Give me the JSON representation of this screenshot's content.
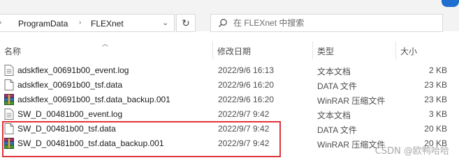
{
  "address_bar": {
    "crumbs": [
      "ProgramData",
      "FLEXnet"
    ],
    "search_placeholder": "在 FLEXnet 中搜索"
  },
  "columns": {
    "name": "名称",
    "date": "修改日期",
    "type": "类型",
    "size": "大小"
  },
  "files": [
    {
      "name": "adskflex_00691b00_event.log",
      "date": "2022/9/6 16:13",
      "type": "文本文档",
      "size": "2 KB",
      "icon": "text-file-icon"
    },
    {
      "name": "adskflex_00691b00_tsf.data",
      "date": "2022/9/6 16:20",
      "type": "DATA 文件",
      "size": "23 KB",
      "icon": "blank-file-icon"
    },
    {
      "name": "adskflex_00691b00_tsf.data_backup.001",
      "date": "2022/9/6 16:20",
      "type": "WinRAR 压缩文件",
      "size": "23 KB",
      "icon": "winrar-archive-icon"
    },
    {
      "name": "SW_D_00481b00_event.log",
      "date": "2022/9/7 9:42",
      "type": "文本文档",
      "size": "3 KB",
      "icon": "text-file-icon"
    },
    {
      "name": "SW_D_00481b00_tsf.data",
      "date": "2022/9/7 9:42",
      "type": "DATA 文件",
      "size": "20 KB",
      "icon": "blank-file-icon"
    },
    {
      "name": "SW_D_00481b00_tsf.data_backup.001",
      "date": "2022/9/7 9:42",
      "type": "WinRAR 压缩文件",
      "size": "20 KB",
      "icon": "winrar-archive-icon"
    }
  ],
  "watermark": "CSDN @欧鸭哈哈"
}
